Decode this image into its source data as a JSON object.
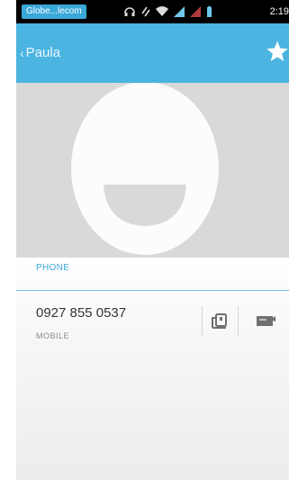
{
  "statusbar": {
    "carrier": "Globe...lecom",
    "time": "2:19"
  },
  "actionbar": {
    "back_label": "Paula",
    "star_icon": "star-icon"
  },
  "contact": {
    "photo_icon": "default-contact-photo-icon",
    "section_header": "PHONE",
    "phone_number": "0927 855 0537",
    "phone_type": "MOBILE",
    "actions": [
      "call-icon",
      "message-icon"
    ]
  },
  "colors": {
    "accent": "#3aa8d8",
    "actionbar": "#4cb4e0"
  }
}
